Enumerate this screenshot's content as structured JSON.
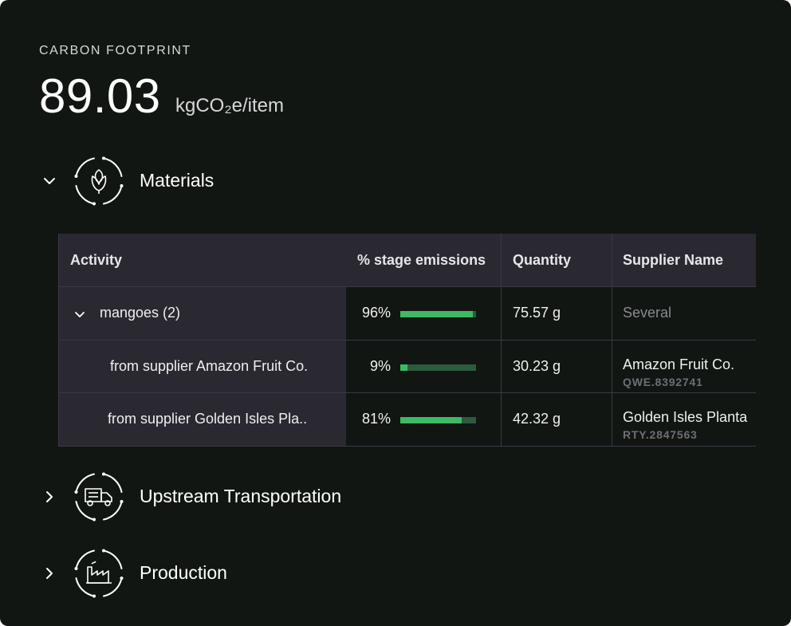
{
  "header": {
    "label": "CARBON FOOTPRINT",
    "value": "89.03",
    "unit": "kgCO₂e/item"
  },
  "stages": [
    {
      "name": "Materials",
      "icon": "leaf-icon",
      "expanded": true
    },
    {
      "name": "Upstream Transportation",
      "icon": "truck-icon",
      "expanded": false
    },
    {
      "name": "Production",
      "icon": "factory-icon",
      "expanded": false
    }
  ],
  "table": {
    "columns": [
      "Activity",
      "% stage emissions",
      "Quantity",
      "Supplier Name"
    ],
    "rows": [
      {
        "activity": "mangoes (2)",
        "pct_label": "96%",
        "pct": 0.96,
        "quantity": "75.57 g",
        "supplier": "Several",
        "code": ""
      },
      {
        "activity": "from supplier Amazon Fruit Co.",
        "pct_label": "9%",
        "pct": 0.09,
        "quantity": "30.23 g",
        "supplier": "Amazon Fruit Co.",
        "code": "QWE.8392741"
      },
      {
        "activity": "from supplier Golden Isles Pla..",
        "pct_label": "81%",
        "pct": 0.81,
        "quantity": "42.32 g",
        "supplier": "Golden Isles Planta",
        "code": "RTY.2847563"
      }
    ]
  },
  "colors": {
    "background": "#111613",
    "header_row": "#2a2830",
    "bar_fill": "#3dba63",
    "bar_track": "#2d5a3c"
  }
}
